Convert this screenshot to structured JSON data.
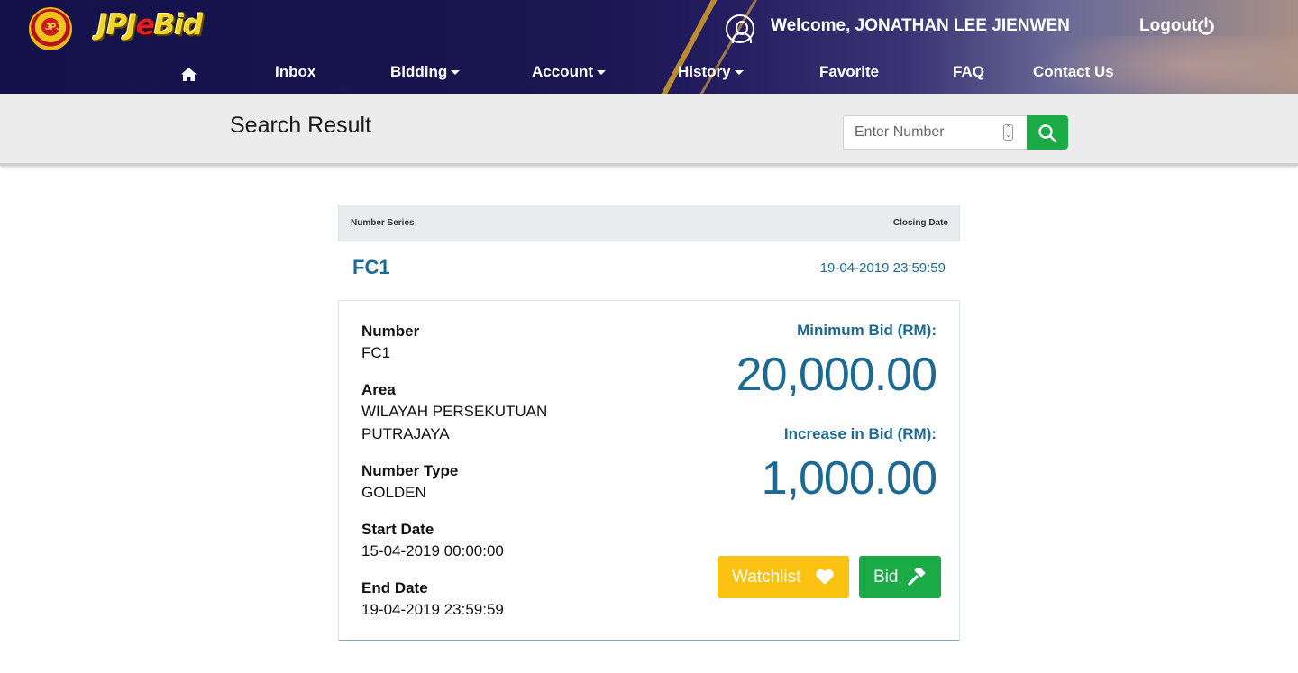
{
  "header": {
    "logo_prefix": "JPJ",
    "logo_e": "e",
    "logo_suffix": "Bid",
    "welcome_text": "Welcome, JONATHAN LEE JIENWEN",
    "logout_label": "Logout",
    "crest_text": "JPJ"
  },
  "nav": {
    "inbox": "Inbox",
    "bidding": "Bidding",
    "account": "Account",
    "history": "History",
    "favorite": "Favorite",
    "faq": "FAQ",
    "contact": "Contact Us"
  },
  "search": {
    "title": "Search Result",
    "placeholder": "Enter Number"
  },
  "result": {
    "col_series": "Number Series",
    "col_closing": "Closing Date",
    "series": "FC1",
    "closing_date": "19-04-2019 23:59:59"
  },
  "details": {
    "number_label": "Number",
    "number_value": "FC1",
    "area_label": "Area",
    "area_line1": "WILAYAH PERSEKUTUAN",
    "area_line2": "PUTRAJAYA",
    "type_label": "Number Type",
    "type_value": "GOLDEN",
    "start_label": "Start Date",
    "start_value": "15-04-2019 00:00:00",
    "end_label": "End Date",
    "end_value": "19-04-2019 23:59:59",
    "min_bid_label": "Minimum Bid (RM):",
    "min_bid_value": "20,000.00",
    "increase_label": "Increase in Bid (RM):",
    "increase_value": "1,000.00",
    "watchlist_label": "Watchlist",
    "bid_label": "Bid"
  },
  "colors": {
    "header_bg": "#14104a",
    "accent_teal": "#1c6a94",
    "green": "#1aab47",
    "yellow": "#fcc211"
  }
}
